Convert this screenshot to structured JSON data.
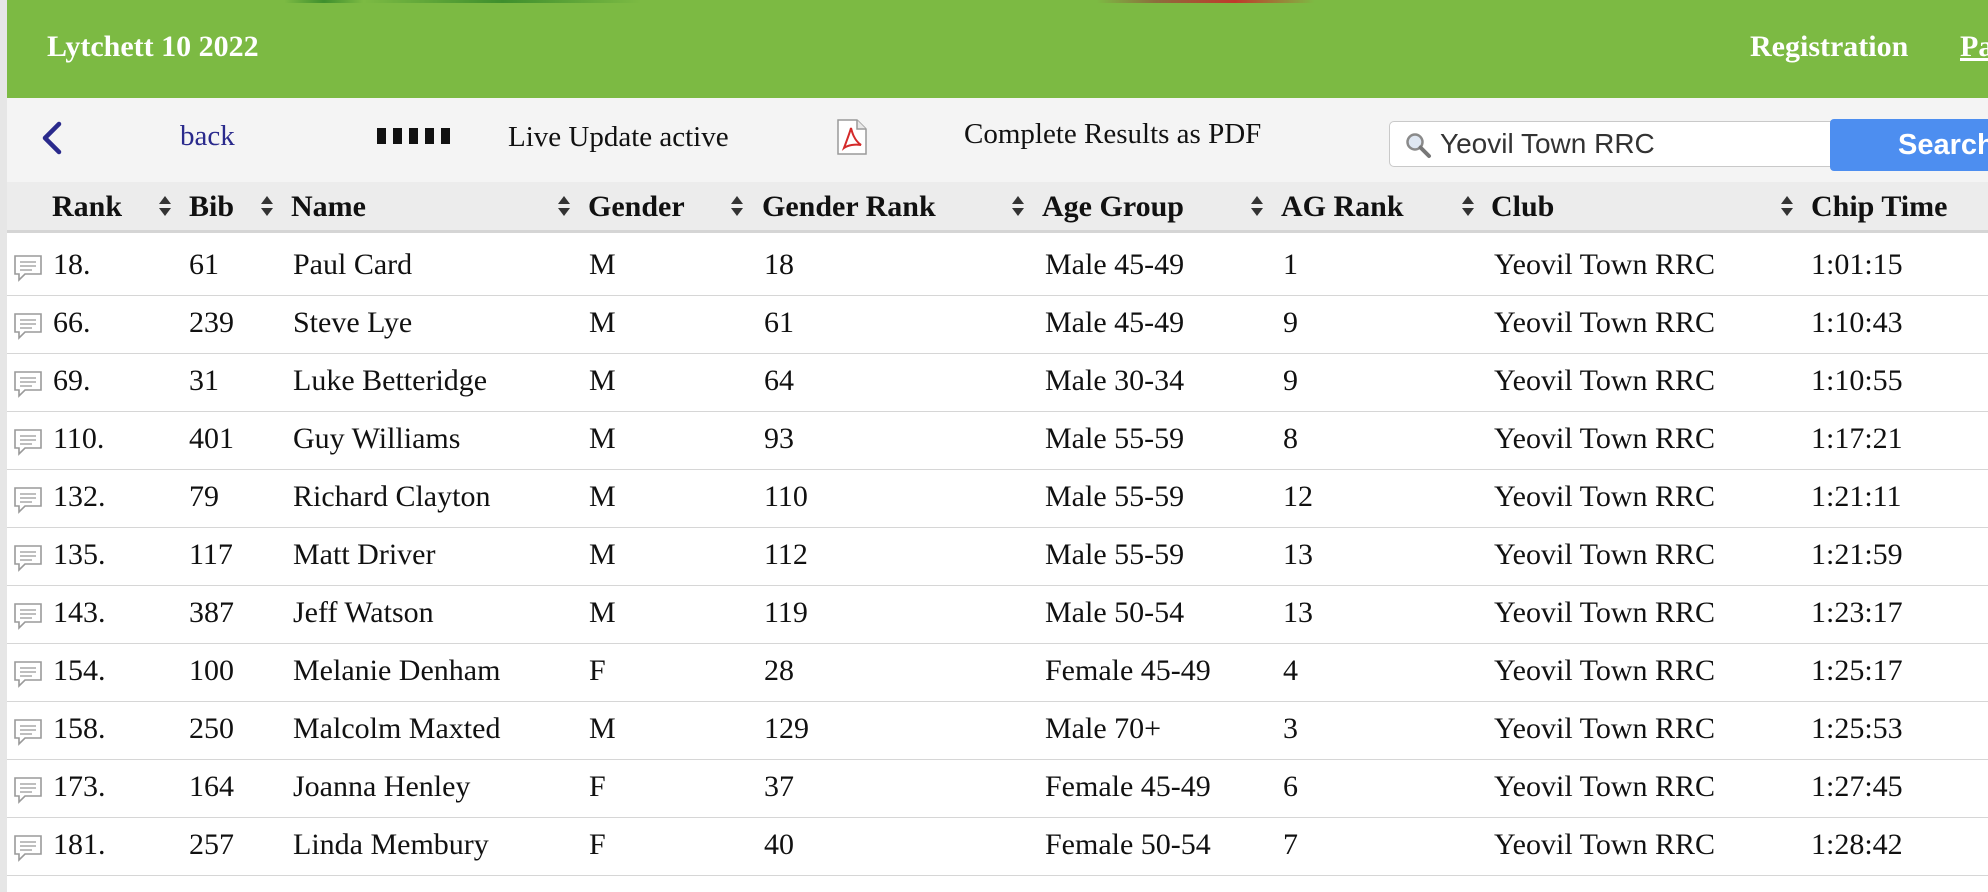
{
  "header": {
    "title": "Lytchett 10 2022",
    "nav": [
      "Registration",
      "Pa"
    ],
    "color": "#7cba43"
  },
  "toolbar": {
    "back_label": "back",
    "live_label": "Live Update active",
    "pdf_label": "Complete Results as PDF",
    "search_value": "Yeovil Town RRC",
    "search_button": "Search"
  },
  "columns": [
    "Rank",
    "Bib",
    "Name",
    "Gender",
    "Gender Rank",
    "Age Group",
    "AG Rank",
    "Club",
    "Chip Time"
  ],
  "rows": [
    [
      "18.",
      "61",
      "Paul Card",
      "M",
      "18",
      "Male 45-49",
      "1",
      "Yeovil Town RRC",
      "1:01:15"
    ],
    [
      "66.",
      "239",
      "Steve Lye",
      "M",
      "61",
      "Male 45-49",
      "9",
      "Yeovil Town RRC",
      "1:10:43"
    ],
    [
      "69.",
      "31",
      "Luke Betteridge",
      "M",
      "64",
      "Male 30-34",
      "9",
      "Yeovil Town RRC",
      "1:10:55"
    ],
    [
      "110.",
      "401",
      "Guy Williams",
      "M",
      "93",
      "Male 55-59",
      "8",
      "Yeovil Town RRC",
      "1:17:21"
    ],
    [
      "132.",
      "79",
      "Richard Clayton",
      "M",
      "110",
      "Male 55-59",
      "12",
      "Yeovil Town RRC",
      "1:21:11"
    ],
    [
      "135.",
      "117",
      "Matt Driver",
      "M",
      "112",
      "Male 55-59",
      "13",
      "Yeovil Town RRC",
      "1:21:59"
    ],
    [
      "143.",
      "387",
      "Jeff Watson",
      "M",
      "119",
      "Male 50-54",
      "13",
      "Yeovil Town RRC",
      "1:23:17"
    ],
    [
      "154.",
      "100",
      "Melanie Denham",
      "F",
      "28",
      "Female 45-49",
      "4",
      "Yeovil Town RRC",
      "1:25:17"
    ],
    [
      "158.",
      "250",
      "Malcolm Maxted",
      "M",
      "129",
      "Male 70+",
      "3",
      "Yeovil Town RRC",
      "1:25:53"
    ],
    [
      "173.",
      "164",
      "Joanna Henley",
      "F",
      "37",
      "Female 45-49",
      "6",
      "Yeovil Town RRC",
      "1:27:45"
    ],
    [
      "181.",
      "257",
      "Linda Membury",
      "F",
      "40",
      "Female 50-54",
      "7",
      "Yeovil Town RRC",
      "1:28:42"
    ]
  ],
  "icons": {
    "back": "chevron-left-icon",
    "live": "live-update-icon",
    "pdf": "pdf-icon",
    "search": "magnifier-icon",
    "sort": "sort-icon",
    "row": "comment-icon"
  }
}
